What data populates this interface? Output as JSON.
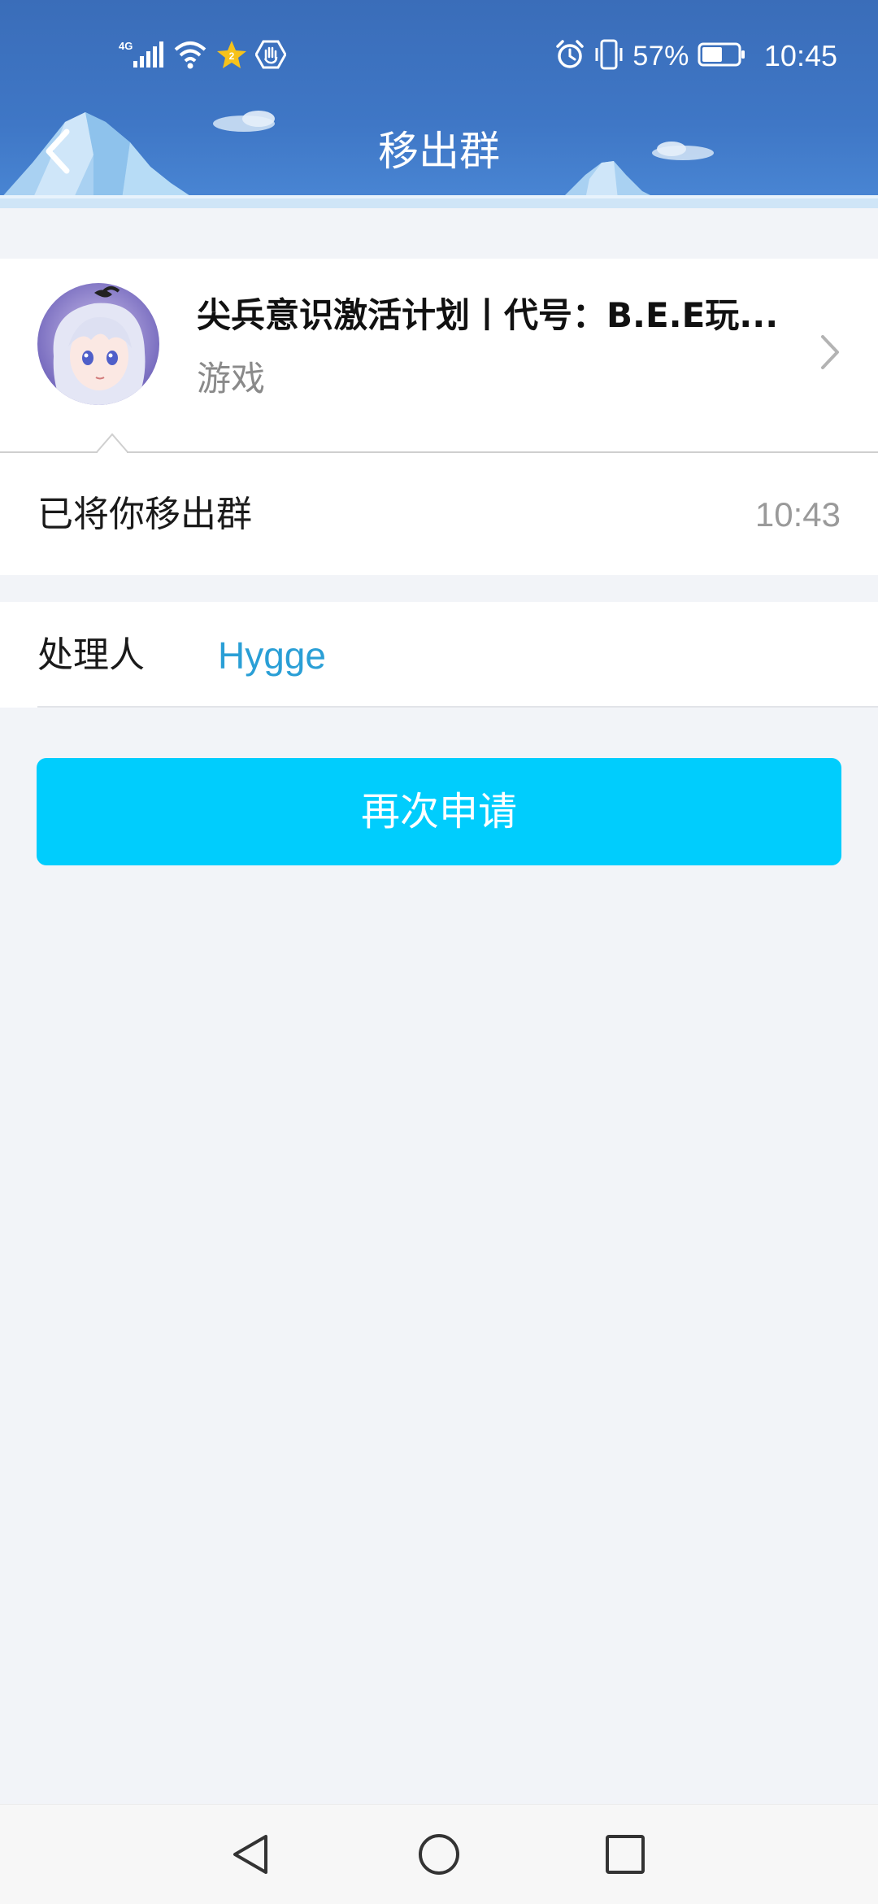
{
  "status_bar": {
    "network": "4G",
    "battery_percent": "57%",
    "battery_level": 0.57,
    "time": "10:45",
    "icons": [
      "signal-icon",
      "wifi-icon",
      "star-badge-icon",
      "hand-badge-icon",
      "alarm-icon",
      "vibrate-icon",
      "battery-icon"
    ]
  },
  "header": {
    "title": "移出群",
    "back_icon": "chevron-left-icon"
  },
  "group": {
    "name": "尖兵意识激活计划丨代号：B.E.E玩...",
    "category": "游戏",
    "chevron_icon": "chevron-right-icon"
  },
  "message": {
    "text": "已将你移出群",
    "time": "10:43"
  },
  "handler": {
    "label": "处理人",
    "name": "Hygge"
  },
  "action": {
    "button_label": "再次申请"
  },
  "colors": {
    "header_blue": "#3a6db9",
    "button_cyan": "#00cdfd",
    "link_blue": "#2a9fd6",
    "background": "#f2f4f8"
  },
  "nav": {
    "icons": [
      "back-triangle-icon",
      "home-circle-icon",
      "recents-square-icon"
    ]
  }
}
